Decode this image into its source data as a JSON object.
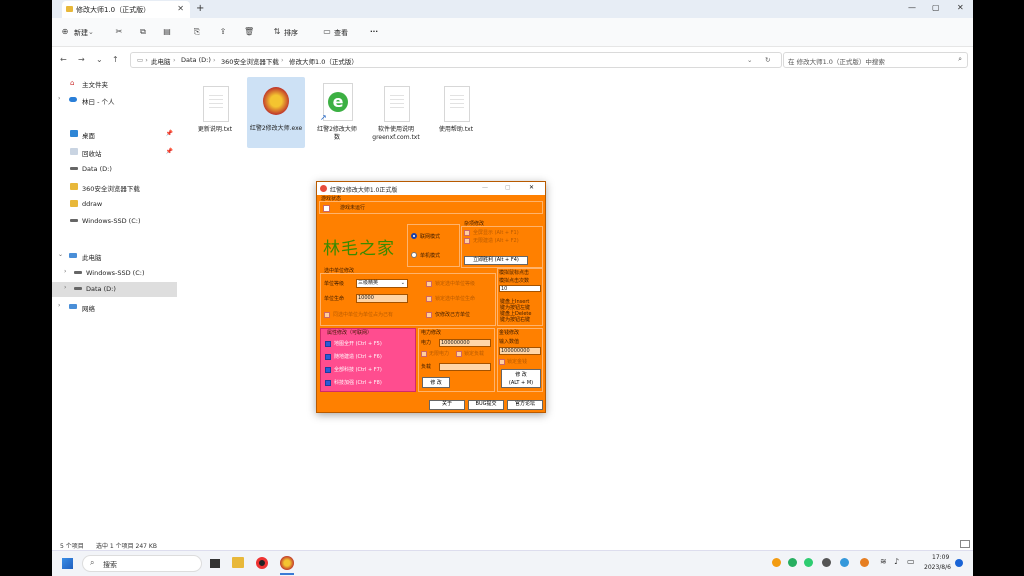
{
  "window": {
    "tab_title": "修改大师1.0（正式版）"
  },
  "toolbar": {
    "new_label": "新建",
    "sort_label": "排序",
    "view_label": "查看",
    "more_label": "···"
  },
  "address": {
    "crumbs": [
      "此电脑",
      "Data (D:)",
      "360安全浏览器下载",
      "修改大师1.0（正式版）"
    ],
    "search_placeholder": "在 修改大师1.0（正式版）中搜索"
  },
  "navpane": {
    "items": [
      {
        "label": "主文件夹"
      },
      {
        "label": "林曰 - 个人"
      },
      {
        "label": "桌面"
      },
      {
        "label": "回收站"
      },
      {
        "label": "Data (D:)"
      },
      {
        "label": "360安全浏览器下载"
      },
      {
        "label": "ddraw"
      },
      {
        "label": "Windows-SSD (C:)"
      },
      {
        "label": "此电脑"
      },
      {
        "label": "Windows-SSD (C:)"
      },
      {
        "label": "Data (D:)"
      },
      {
        "label": "网络"
      }
    ]
  },
  "files": [
    {
      "name": "更新说明.txt"
    },
    {
      "name": "红警2修改大师.exe"
    },
    {
      "name": "红警2修改大师\n数"
    },
    {
      "name": "软件使用说明\ngreenxf.com.txt"
    },
    {
      "name": "使用帮助.txt"
    }
  ],
  "status": {
    "count": "5 个项目",
    "selected": "选中 1 个项目 247 KB"
  },
  "taskbar": {
    "search": "搜索",
    "time": "17:09",
    "date": "2023/8/6"
  },
  "dialog": {
    "title": "红警2修改大师1.0正式版",
    "game_status_title": "游戏状态",
    "game_status_value": "游戏未运行",
    "logo_text": "林毛之家",
    "mode_online": "联网模式",
    "mode_single": "单机模式",
    "misc_title": "杂项修改",
    "misc_1": "全屏显示 (Alt + F1)",
    "misc_2": "无限建造 (Alt + F2)",
    "misc_btn": "立即胜利 (Alt + F4)",
    "unit_title": "选中单位修改",
    "unit_level_label": "单位等级",
    "unit_level_value": "三级精英",
    "unit_hp_label": "单位生命",
    "unit_hp_value": "10000",
    "unit_opt_1": "锁定选中单位等级",
    "unit_opt_2": "锁定选中单位生命",
    "unit_opt_3": "同选中单位为单位占为己有",
    "unit_opt_4": "仅修改己方单位",
    "click_title": "模拟鼠标点击",
    "click_sub": "模拟点击次数",
    "click_value": "10",
    "click_keys": [
      "键盘上Insert",
      "键为按钮左键",
      "键盘上Delete",
      "键为按钮右键"
    ],
    "attr_title": "属性修改（可联网）",
    "attr_1": "地图全开 (Ctrl + F5)",
    "attr_2": "随地建造 (Ctrl + F6)",
    "attr_3": "全部科技 (Ctrl + F7)",
    "attr_4": "科技加强 (Ctrl + F8)",
    "power_title": "电力修改",
    "power_label": "电力",
    "power_value": "100000000",
    "power_opt_1": "无限电力",
    "power_opt_2": "锁定负载",
    "load_label": "负载",
    "power_btn": "修 改",
    "money_title": "金钱修改",
    "money_label": "输入数值",
    "money_value": "100000000",
    "money_opt": "锁定金钱",
    "money_btn": "修 改\n(ALT + M)",
    "btn_close": "关于",
    "btn_bug": "BUG提交",
    "btn_forum": "官方论坛"
  }
}
